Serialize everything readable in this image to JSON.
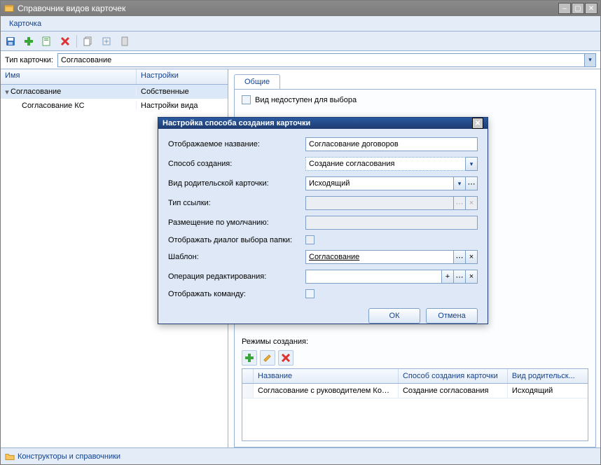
{
  "window": {
    "title": "Справочник видов карточек"
  },
  "menubar": {
    "card": "Карточка"
  },
  "cardtype": {
    "label": "Тип карточки:",
    "value": "Согласование"
  },
  "tree": {
    "headers": {
      "name": "Имя",
      "settings": "Настройки"
    },
    "rows": [
      {
        "name": "Согласование",
        "settings": "Собственные",
        "expandable": true
      },
      {
        "name": "Согласование КС",
        "settings": "Настройки вида",
        "expandable": false
      }
    ]
  },
  "tabs": {
    "general": "Общие"
  },
  "general": {
    "checkbox_unavailable": "Вид недоступен для выбора",
    "modes_label": "Режимы создания:"
  },
  "grid": {
    "columns": {
      "name": "Название",
      "method": "Способ создания карточки",
      "parent": "Вид родительск..."
    },
    "rows": [
      {
        "name": "Согласование с руководителем Коммерческого отдела",
        "method": "Создание согласования",
        "parent": "Исходящий"
      }
    ]
  },
  "footer": {
    "constructors": "Конструкторы и справочники"
  },
  "dialog": {
    "title": "Настройка способа создания карточки",
    "fields": {
      "display_name_label": "Отображаемое название:",
      "display_name_value": "Согласование договоров",
      "method_label": "Способ создания:",
      "method_value": "Создание согласования",
      "parent_label": "Вид родительской карточки:",
      "parent_value": "Исходящий",
      "linktype_label": "Тип ссылки:",
      "linktype_value": "",
      "placement_label": "Размещение по умолчанию:",
      "placement_value": "",
      "show_folder_dlg_label": "Отображать диалог выбора папки:",
      "template_label": "Шаблон:",
      "template_value": "Согласование",
      "edit_op_label": "Операция редактирования:",
      "edit_op_value": "",
      "show_cmd_label": "Отображать команду:"
    },
    "buttons": {
      "ok": "ОК",
      "cancel": "Отмена"
    }
  }
}
